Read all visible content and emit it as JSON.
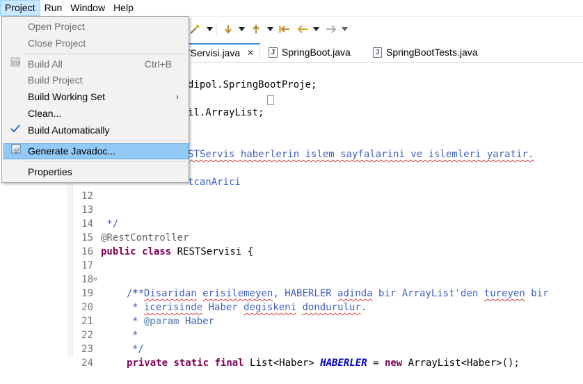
{
  "menubar": {
    "items": [
      "Project",
      "Run",
      "Window",
      "Help"
    ]
  },
  "dropdown": {
    "items": [
      {
        "label": "Open Project",
        "enabled": false
      },
      {
        "label": "Close Project",
        "enabled": false
      },
      {
        "label": "Build All",
        "accelerator": "Ctrl+B",
        "enabled": false
      },
      {
        "label": "Build Project",
        "enabled": false
      },
      {
        "label": "Build Working Set",
        "submenu": true,
        "enabled": true
      },
      {
        "label": "Clean...",
        "enabled": true
      },
      {
        "label": "Build Automatically",
        "checked": true,
        "enabled": true
      },
      {
        "label": "Generate Javadoc...",
        "highlighted": true,
        "enabled": true
      },
      {
        "label": "Properties",
        "enabled": true
      }
    ]
  },
  "tabs": [
    {
      "label": "RESTServisi.java",
      "visible_label": "TServisi.java",
      "active": true
    },
    {
      "label": "SpringBoot.java",
      "active": false
    },
    {
      "label": "SpringBootTests.java",
      "active": false
    }
  ],
  "editor": {
    "lines": [
      {
        "num": "",
        "text": "dipol.SpringBootProje;"
      },
      {
        "num": "",
        "text": ""
      },
      {
        "num": "",
        "text": "il.ArrayList;"
      },
      {
        "num": "",
        "text": ""
      },
      {
        "num": "",
        "text": ""
      },
      {
        "num": "",
        "text": "STServis haberlerin islem sayfalarini ve islemleri yaratir."
      },
      {
        "num": "",
        "text": ""
      },
      {
        "num": "",
        "text": "tcanArici"
      },
      {
        "num": "12",
        "text": ""
      },
      {
        "num": "13",
        "text": " */"
      },
      {
        "num": "14",
        "text": "@RestController"
      },
      {
        "num": "15",
        "text": "public class RESTServisi {"
      },
      {
        "num": "16",
        "text": ""
      },
      {
        "num": "17",
        "text": "    /**"
      },
      {
        "num": "18",
        "text": "     * Disaridan erisilemeyen, HABERLER adinda bir ArrayList'den tureyen bir"
      },
      {
        "num": "19",
        "text": "     * icerisinde Haber degiskeni dondurulur."
      },
      {
        "num": "20",
        "text": "     * @param Haber"
      },
      {
        "num": "21",
        "text": "     *"
      },
      {
        "num": "22",
        "text": "     */"
      },
      {
        "num": "23",
        "text": "    private static final List<Haber> HABERLER = new ArrayList<Haber>();"
      },
      {
        "num": "24",
        "text": ""
      }
    ],
    "tokens": {
      "l0": "dipol.SpringBootProje;",
      "l2": "il.ArrayList;",
      "l5": "STServis haberlerin islem sayfalarini ve islemleri yaratir.",
      "l7": "tcanArici",
      "l13_a": " */",
      "l14": "@RestController",
      "l15_kw1": "public",
      "l15_kw2": "class",
      "l15_rest": " RESTServisi {",
      "l17": "/**",
      "l18_a": "* ",
      "l18_b": "Disaridan",
      "l18_c": " ",
      "l18_d": "erisilemeyen",
      "l18_e": ", HABERLER ",
      "l18_f": "adinda",
      "l18_g": " bir ArrayList'den ",
      "l18_h": "tureyen",
      "l18_i": " bir",
      "l19_a": "* ",
      "l19_b": "icerisinde",
      "l19_c": " Haber ",
      "l19_d": "degiskeni",
      "l19_e": " ",
      "l19_f": "dondurulur",
      "l19_g": ".",
      "l20_a": "* ",
      "l20_b": "@param",
      "l20_c": " Haber",
      "l21": "*",
      "l22": "*/",
      "l23_kw1": "private",
      "l23_kw2": "static",
      "l23_kw3": "final",
      "l23_b": " List<Haber> ",
      "l23_field": "HABERLER",
      "l23_c": " = ",
      "l23_kw4": "new",
      "l23_d": " ArrayList<Haber>();"
    }
  },
  "colors": {
    "keyword": "#7f0055",
    "javadoc": "#3f5fbf",
    "annotation": "#646464",
    "highlight": "#91c9f7"
  }
}
